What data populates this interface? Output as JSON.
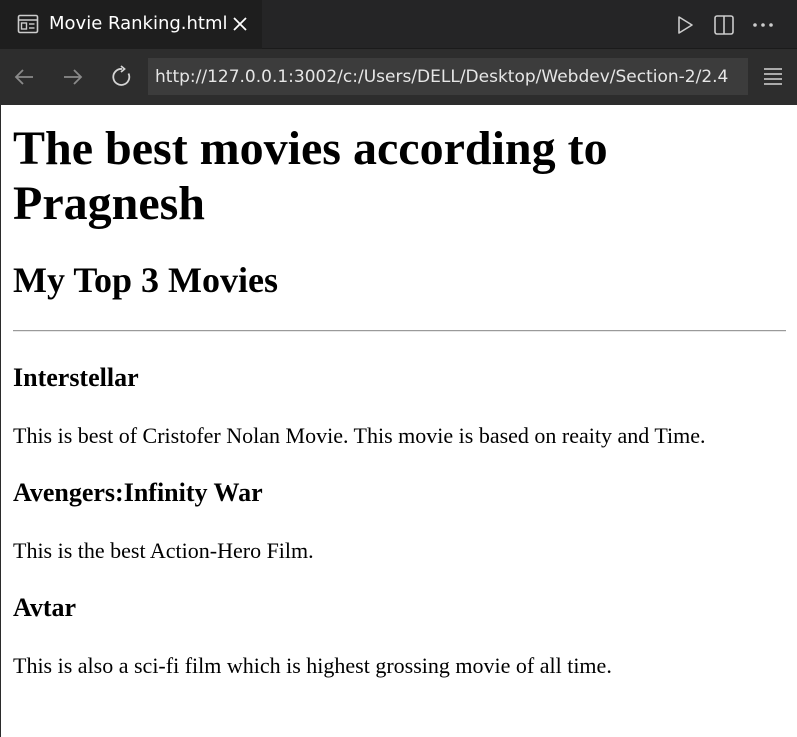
{
  "tab": {
    "title": "Movie Ranking.html",
    "icon": "preview-icon",
    "close_icon": "close-icon"
  },
  "tab_actions": [
    "run-icon",
    "split-editor-icon",
    "more-icon"
  ],
  "nav": {
    "url": "http://127.0.0.1:3002/c:/Users/DELL/Desktop/Webdev/Section-2/2.4",
    "icons": [
      "back-icon",
      "forward-icon",
      "reload-icon",
      "menu-icon"
    ]
  },
  "page": {
    "heading": "The best movies according to Pragnesh",
    "subheading": "My Top 3 Movies",
    "movies": [
      {
        "title": "Interstellar",
        "description": "This is best of Cristofer Nolan Movie. This movie is based on reaity and Time."
      },
      {
        "title": "Avengers:Infinity War",
        "description": "This is the best Action-Hero Film."
      },
      {
        "title": "Avtar",
        "description": "This is also a sci-fi film which is highest grossing movie of all time."
      }
    ]
  },
  "colors": {
    "tab_bg": "#1e1e1e",
    "tabbar_bg": "#252526",
    "navbar_bg": "#2d2d2d",
    "urlbar_bg": "#3c3c3c",
    "page_bg": "#ffffff"
  }
}
